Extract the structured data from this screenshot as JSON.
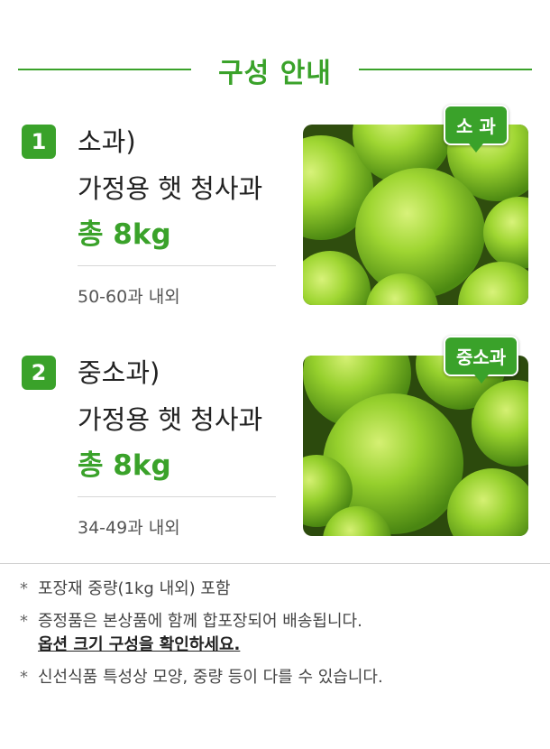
{
  "header": {
    "title": "구성 안내"
  },
  "items": [
    {
      "number": "1",
      "name": "소과)",
      "desc": "가정용 햇 청사과",
      "total": "총 8kg",
      "count": "50-60과 내외",
      "badge": "소 과"
    },
    {
      "number": "2",
      "name": "중소과)",
      "desc": "가정용 햇 청사과",
      "total": "총 8kg",
      "count": "34-49과 내외",
      "badge": "중소과"
    }
  ],
  "notes": [
    {
      "star": "*",
      "text": "포장재 중량(1kg 내외) 포함"
    },
    {
      "star": "*",
      "text": "증정품은 본상품에 함께 합포장되어 배송됩니다.",
      "emph": "옵션 크기 구성을 확인하세요."
    },
    {
      "star": "*",
      "text": "신선식품 특성상 모양, 중량 등이 다를 수 있습니다."
    }
  ],
  "colors": {
    "accent": "#3aa22a",
    "apple": "#8fce2e"
  }
}
